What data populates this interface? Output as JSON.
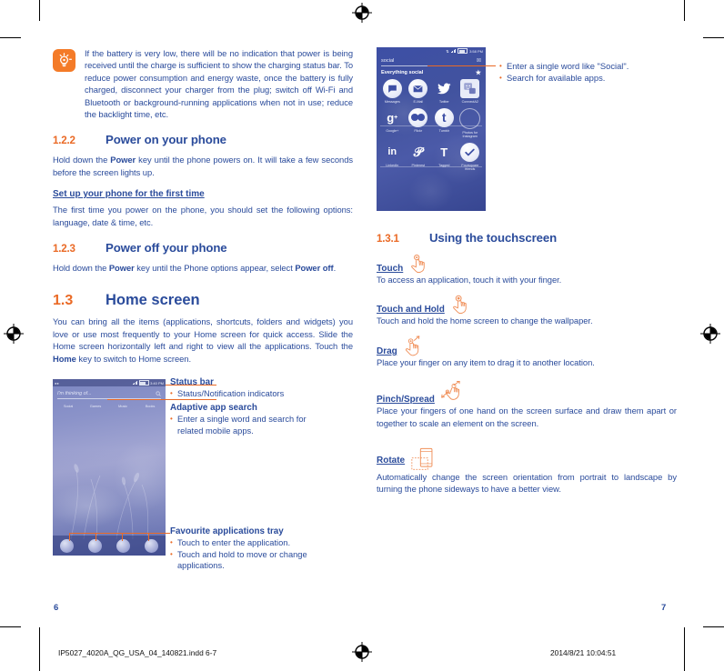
{
  "document": {
    "left_page_number": "6",
    "right_page_number": "7",
    "footer_filename": "IP5027_4020A_QG_USA_04_140821.indd   6-7",
    "footer_timestamp": "2014/8/21   10:04:51"
  },
  "colors": {
    "heading_blue": "#2a4b9b",
    "accent_orange": "#ea6a26",
    "tip_icon_bg": "#f47b28",
    "body_blue": "#2a4b9b"
  },
  "left_page": {
    "tip": {
      "icon": "lightbulb-icon",
      "text": "If the battery is very low, there will be no indication that power is being received until the charge is sufficient to show the charging status bar. To reduce power consumption and energy waste, once the battery is fully charged, disconnect your charger from the plug; switch off Wi-Fi and Bluetooth or background-running applications when not in use; reduce the backlight time, etc."
    },
    "section_122": {
      "number": "1.2.2",
      "title": "Power on your phone",
      "body_before": "Hold down the ",
      "body_bold": "Power",
      "body_after": " key until the phone powers on. It will take a few seconds before the screen lights up.",
      "subheading": "Set up your phone for the first time",
      "sub_body": "The first time you power on the phone, you should set the following options: language, date & time, etc."
    },
    "section_123": {
      "number": "1.2.3",
      "title": "Power off your phone",
      "body_a": "Hold down the ",
      "body_bold_1": "Power",
      "body_b": " key until the Phone options appear, select ",
      "body_bold_2": "Power off",
      "body_c": "."
    },
    "section_13": {
      "number": "1.3",
      "title": "Home screen",
      "body": "You can bring all the items (applications, shortcuts, folders and widgets) you love or use most frequently to your Home screen for quick access. Slide the Home screen horizontally left and right to view all the applications. Touch the ",
      "body_bold": "Home",
      "body_after": " key to switch to Home screen."
    },
    "phone_screenshot": {
      "status_bar_time": "3:40 PM",
      "search_placeholder": "I'm thinking of...",
      "search_icon": "search-icon",
      "apps": [
        {
          "label": "Social",
          "icon": "social-app-icon"
        },
        {
          "label": "Games",
          "icon": "games-app-icon"
        },
        {
          "label": "Music",
          "icon": "music-app-icon"
        },
        {
          "label": "Books",
          "icon": "books-app-icon"
        }
      ],
      "tray": [
        {
          "name": "phone-tray-icon"
        },
        {
          "name": "messages-tray-icon"
        },
        {
          "name": "contacts-tray-icon"
        },
        {
          "name": "browser-tray-icon"
        }
      ]
    },
    "callouts": [
      {
        "title": "Status bar",
        "items": [
          "Status/Notification indicators"
        ]
      },
      {
        "title": "Adaptive app search",
        "items": [
          "Enter a single word and search for related mobile apps."
        ]
      },
      {
        "title": "Favourite applications tray",
        "items": [
          "Touch to enter the application.",
          "Touch and hold to move or change applications."
        ]
      }
    ]
  },
  "right_page": {
    "phone_screenshot": {
      "status_bar_time": "3:58 PM",
      "query_text": "social",
      "clear_icon": "clear-icon",
      "everything_label": "Everything social",
      "star_icon": "star-icon",
      "apps": [
        {
          "label": "Messages",
          "glyph": "messages-icon"
        },
        {
          "label": "E-Mail",
          "glyph": "email-icon"
        },
        {
          "label": "Twitter",
          "glyph": "twitter-icon"
        },
        {
          "label": "ConnectA2",
          "glyph": "connecta2-icon"
        },
        {
          "label": "Google+",
          "glyph": "googleplus-icon"
        },
        {
          "label": "Flickr",
          "glyph": "flickr-icon"
        },
        {
          "label": "Tumblr",
          "glyph": "tumblr-icon"
        },
        {
          "label": "Photos for Instagram",
          "glyph": "instagram-icon"
        },
        {
          "label": "LinkedIn",
          "glyph": "linkedin-icon"
        },
        {
          "label": "Pinterest",
          "glyph": "pinterest-icon"
        },
        {
          "label": "Tagged",
          "glyph": "tagged-icon"
        },
        {
          "label": "Foursquare friends",
          "glyph": "foursquare-icon"
        }
      ]
    },
    "bullets": [
      "Enter a single word like \"Social\".",
      "Search for available apps."
    ],
    "section_131": {
      "number": "1.3.1",
      "title": "Using the touchscreen"
    },
    "gestures": [
      {
        "name": "Touch",
        "icon": "touch-gesture-icon",
        "description": "To access an application, touch it with your finger."
      },
      {
        "name": "Touch and Hold",
        "icon": "touch-and-hold-gesture-icon",
        "description": "Touch and hold the home screen to change the wallpaper."
      },
      {
        "name": "Drag",
        "icon": "drag-gesture-icon",
        "description": "Place your finger on any item to drag it to another location."
      },
      {
        "name": "Pinch/Spread",
        "icon": "pinch-spread-gesture-icon",
        "description": "Place your fingers of one hand on the screen surface and draw them apart or together to scale an element on the screen."
      },
      {
        "name": "Rotate",
        "icon": "rotate-gesture-icon",
        "description": "Automatically change the screen orientation from portrait to landscape by turning the phone sideways to have a better view."
      }
    ]
  }
}
